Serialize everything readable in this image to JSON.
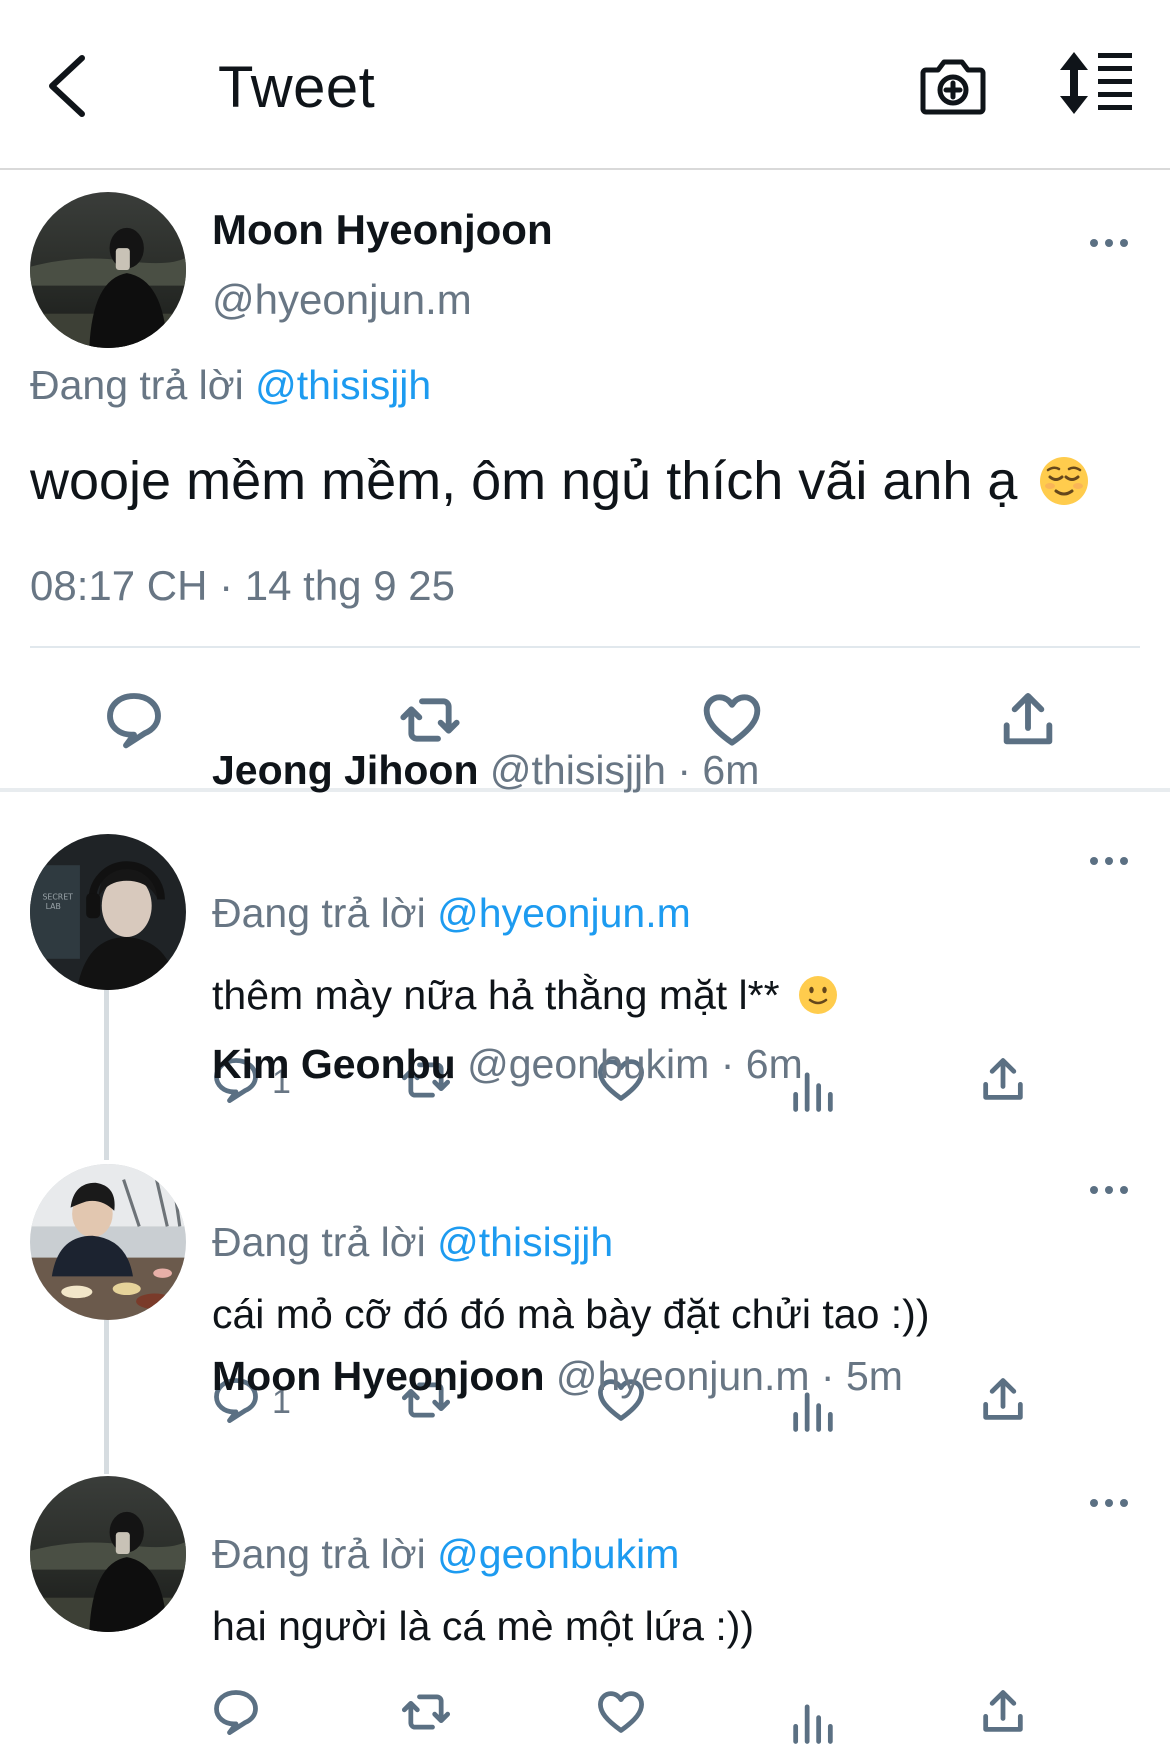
{
  "header": {
    "title": "Tweet",
    "back_icon": "chevron-left-icon",
    "camera_icon": "camera-plus-icon",
    "sort_icon": "sort-icon"
  },
  "main_tweet": {
    "name": "Moon Hyeonjoon",
    "handle": "@hyeonjun.m",
    "reply_prefix": "Đang trả lời",
    "reply_to": "@thisisjjh",
    "text": "wooje mềm mềm, ôm ngủ thích vãi anh ạ",
    "emoji": "relieved-face",
    "timestamp": "08:17 CH · 14 thg 9 25"
  },
  "replies": [
    {
      "name": "Jeong Jihoon",
      "handle": "@thisisjjh",
      "time": "· 6m",
      "reply_prefix": "Đang trả lời",
      "reply_to": "@hyeonjun.m",
      "text": "thêm mày nữa hả thằng mặt l**",
      "emoji": "slightly-smiling-face",
      "reply_count": "1"
    },
    {
      "name": "Kim Geonbu",
      "handle": "@geonbukim",
      "time": "· 6m",
      "reply_prefix": "Đang trả lời",
      "reply_to": "@thisisjjh",
      "text": "cái mỏ cỡ đó đó mà bày đặt chửi tao :))",
      "reply_count": "1"
    },
    {
      "name": "Moon Hyeonjoon",
      "handle": "@hyeonjun.m",
      "time": "· 5m",
      "reply_prefix": "Đang trả lời",
      "reply_to": "@geonbukim",
      "text": "hai người là cá mè một lứa :))",
      "reply_count": ""
    }
  ],
  "colors": {
    "link": "#1d9bf0",
    "secondary_text": "#687684",
    "icon": "#5b7083",
    "divider": "#e1e8ed"
  }
}
